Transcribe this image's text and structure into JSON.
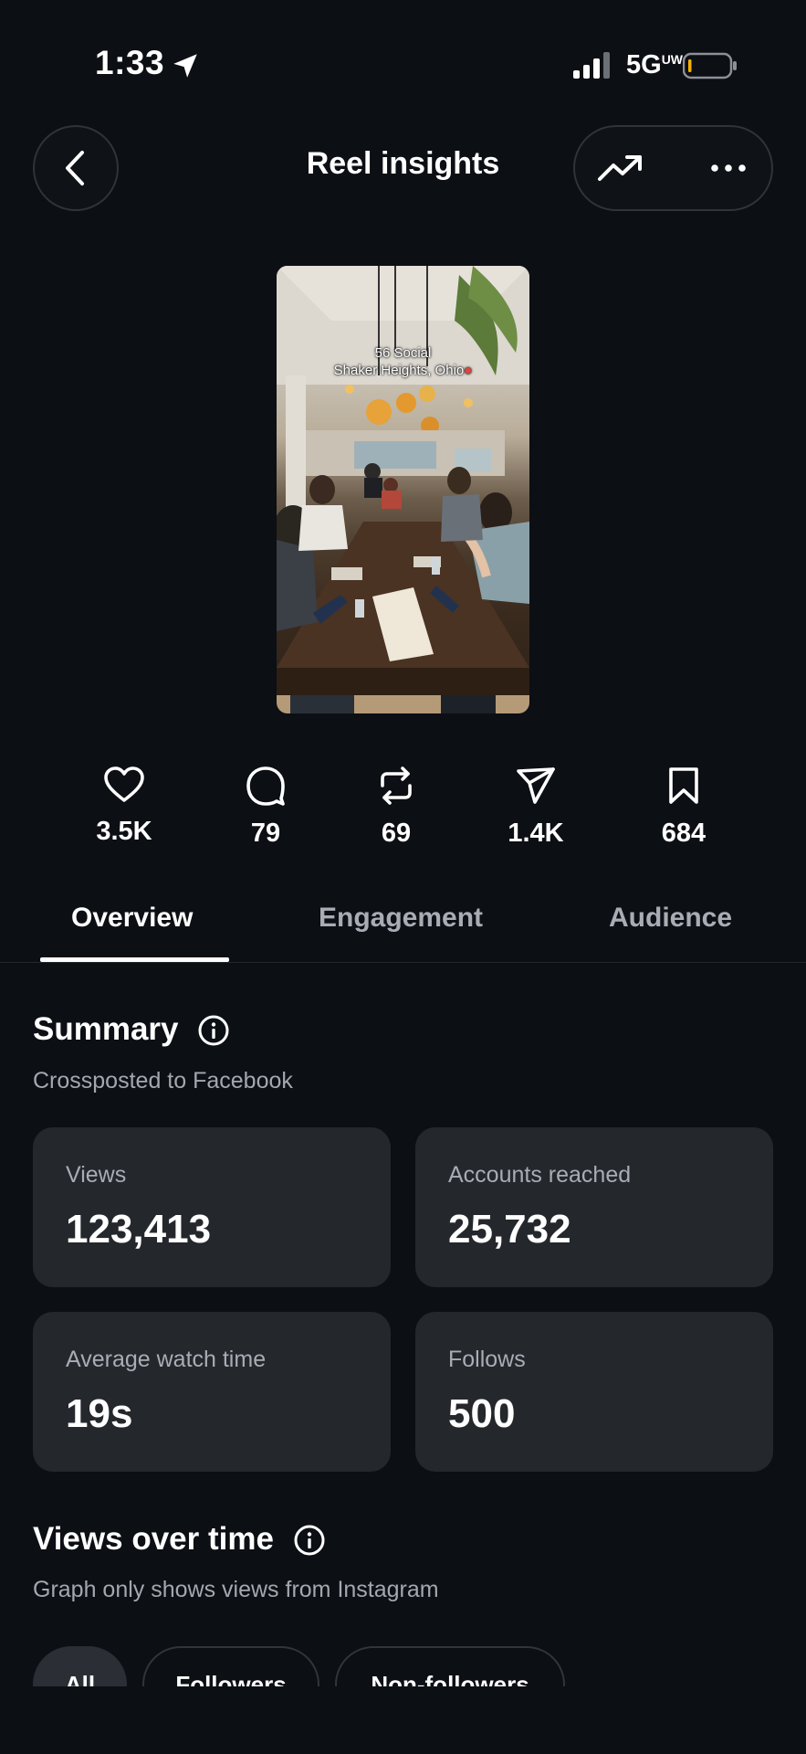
{
  "status_bar": {
    "time": "1:33",
    "network": "5G",
    "network_suffix": "UW",
    "icons": [
      "location-arrow-icon",
      "signal-bars-icon",
      "battery-low-icon"
    ]
  },
  "header": {
    "title": "Reel insights",
    "icons": [
      "chevron-left-icon",
      "trending-up-icon",
      "more-horizontal-icon"
    ]
  },
  "reel": {
    "caption_line1": "56 Social",
    "caption_line2": "Shaker Heights, Ohio"
  },
  "stats": [
    {
      "icon": "heart-icon",
      "value": "3.5K"
    },
    {
      "icon": "comment-icon",
      "value": "79"
    },
    {
      "icon": "repost-icon",
      "value": "69"
    },
    {
      "icon": "share-icon",
      "value": "1.4K"
    },
    {
      "icon": "bookmark-icon",
      "value": "684"
    }
  ],
  "tabs": [
    {
      "label": "Overview",
      "active": true
    },
    {
      "label": "Engagement",
      "active": false
    },
    {
      "label": "Audience",
      "active": false
    }
  ],
  "summary": {
    "title": "Summary",
    "subtitle": "Crossposted to Facebook",
    "cards": [
      {
        "label": "Views",
        "value": "123,413"
      },
      {
        "label": "Accounts reached",
        "value": "25,732"
      },
      {
        "label": "Average watch time",
        "value": "19s"
      },
      {
        "label": "Follows",
        "value": "500"
      }
    ]
  },
  "views_over_time": {
    "title": "Views over time",
    "subtitle": "Graph only shows views from Instagram",
    "filters": [
      {
        "label": "All",
        "active": true
      },
      {
        "label": "Followers",
        "active": false
      },
      {
        "label": "Non-followers",
        "active": false
      }
    ]
  },
  "colors": {
    "background": "#0c0f14",
    "card": "#24272c",
    "muted_text": "#a8adb5",
    "battery_level": "#f5b100"
  }
}
